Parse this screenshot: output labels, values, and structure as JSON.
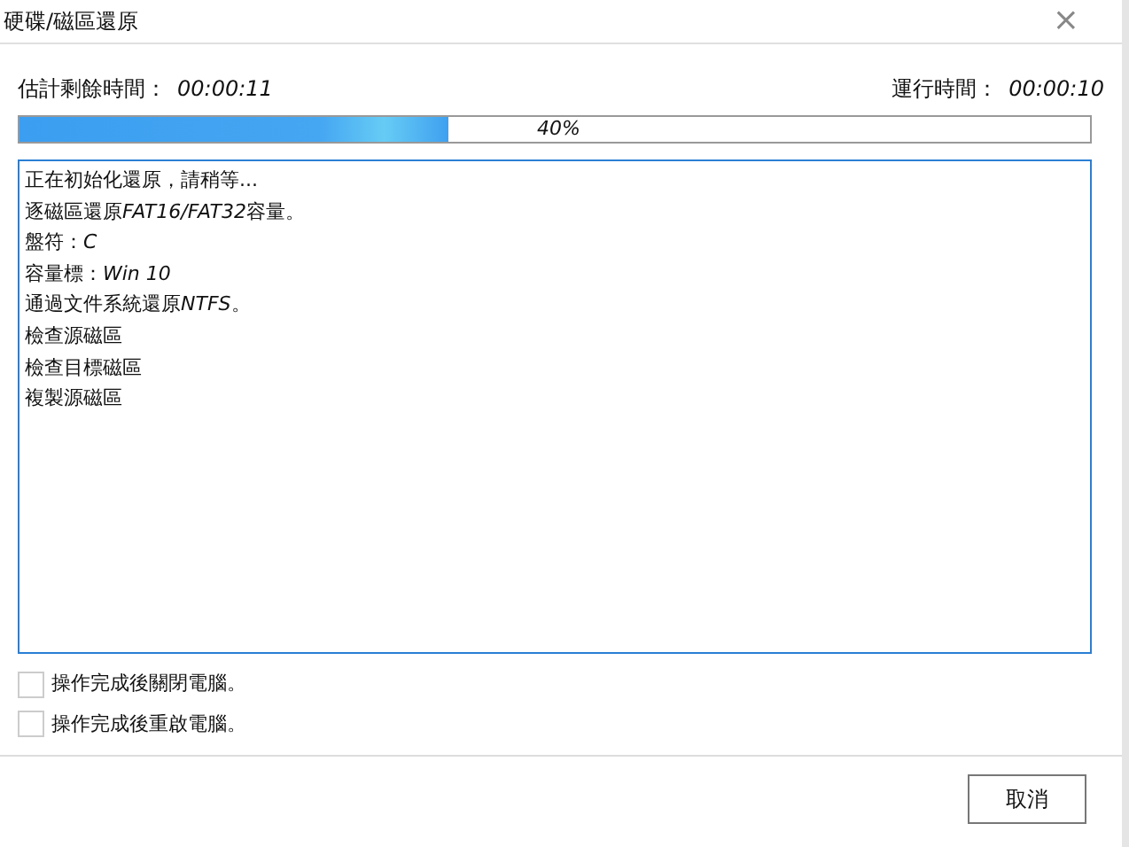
{
  "window": {
    "title": "硬碟/磁區還原",
    "close": "×"
  },
  "times": {
    "remaining_label": "估計剩餘時間：",
    "remaining": "00:00:11",
    "elapsed_label": "運行時間：",
    "elapsed": "00:00:10"
  },
  "progress": {
    "level": 0.4,
    "label": "40%"
  },
  "log": [
    [
      {
        "text": "正在初始化還原，請稍等...",
        "italic": false
      }
    ],
    [
      {
        "text": "逐磁區還原",
        "italic": false
      },
      {
        "text": "FAT16/FAT32",
        "italic": true
      },
      {
        "text": "容量。",
        "italic": false
      }
    ],
    [
      {
        "text": "盤符：",
        "italic": false
      },
      {
        "text": "C",
        "italic": true
      }
    ],
    [
      {
        "text": "容量標：",
        "italic": false
      },
      {
        "text": "Win 10",
        "italic": true
      }
    ],
    [
      {
        "text": "通過文件系統還原",
        "italic": false
      },
      {
        "text": "NTFS",
        "italic": true
      },
      {
        "text": "。",
        "italic": false
      }
    ],
    [
      {
        "text": "檢查源磁區",
        "italic": false
      }
    ],
    [
      {
        "text": "檢查目標磁區",
        "italic": false
      }
    ],
    [
      {
        "text": "複製源磁區",
        "italic": false
      }
    ]
  ],
  "options": [
    {
      "label": "操作完成後關閉電腦。",
      "checked": false
    },
    {
      "label": "操作完成後重啟電腦。",
      "checked": false
    }
  ],
  "buttons": [
    "取消"
  ]
}
